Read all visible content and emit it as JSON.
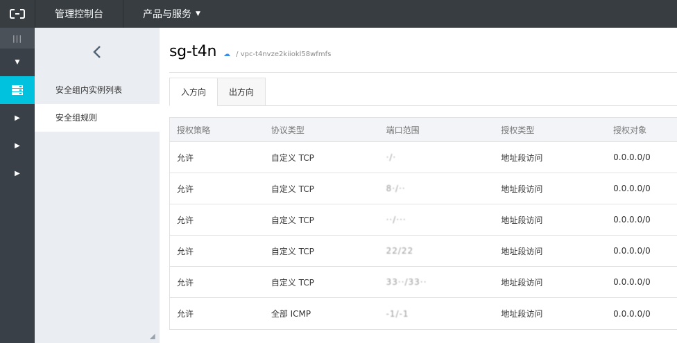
{
  "topbar": {
    "console_label": "管理控制台",
    "products_label": "产品与服务"
  },
  "submenu": {
    "items": [
      {
        "label": "安全组内实例列表"
      },
      {
        "label": "安全组规则"
      }
    ]
  },
  "header": {
    "title": "sg-t4n",
    "vpc": "/  vpc-t4nvze2kiiokl58wfmfs"
  },
  "tabs": [
    {
      "label": "入方向"
    },
    {
      "label": "出方向"
    }
  ],
  "table": {
    "columns": [
      "授权策略",
      "协议类型",
      "端口范围",
      "授权类型",
      "授权对象"
    ],
    "rows": [
      {
        "policy": "允许",
        "protocol": "自定义 TCP",
        "port": "·/·",
        "auth_type": "地址段访问",
        "target": "0.0.0.0/0"
      },
      {
        "policy": "允许",
        "protocol": "自定义 TCP",
        "port": "8·/··",
        "auth_type": "地址段访问",
        "target": "0.0.0.0/0"
      },
      {
        "policy": "允许",
        "protocol": "自定义 TCP",
        "port": "··/···",
        "auth_type": "地址段访问",
        "target": "0.0.0.0/0"
      },
      {
        "policy": "允许",
        "protocol": "自定义 TCP",
        "port": "22/22",
        "auth_type": "地址段访问",
        "target": "0.0.0.0/0"
      },
      {
        "policy": "允许",
        "protocol": "自定义 TCP",
        "port": "33··/33··",
        "auth_type": "地址段访问",
        "target": "0.0.0.0/0"
      },
      {
        "policy": "允许",
        "protocol": "全部 ICMP",
        "port": "-1/-1",
        "auth_type": "地址段访问",
        "target": "0.0.0.0/0"
      }
    ]
  },
  "colors": {
    "topbar_bg": "#373d41",
    "accent": "#00c1de",
    "submenu_bg": "#eaedf1"
  }
}
